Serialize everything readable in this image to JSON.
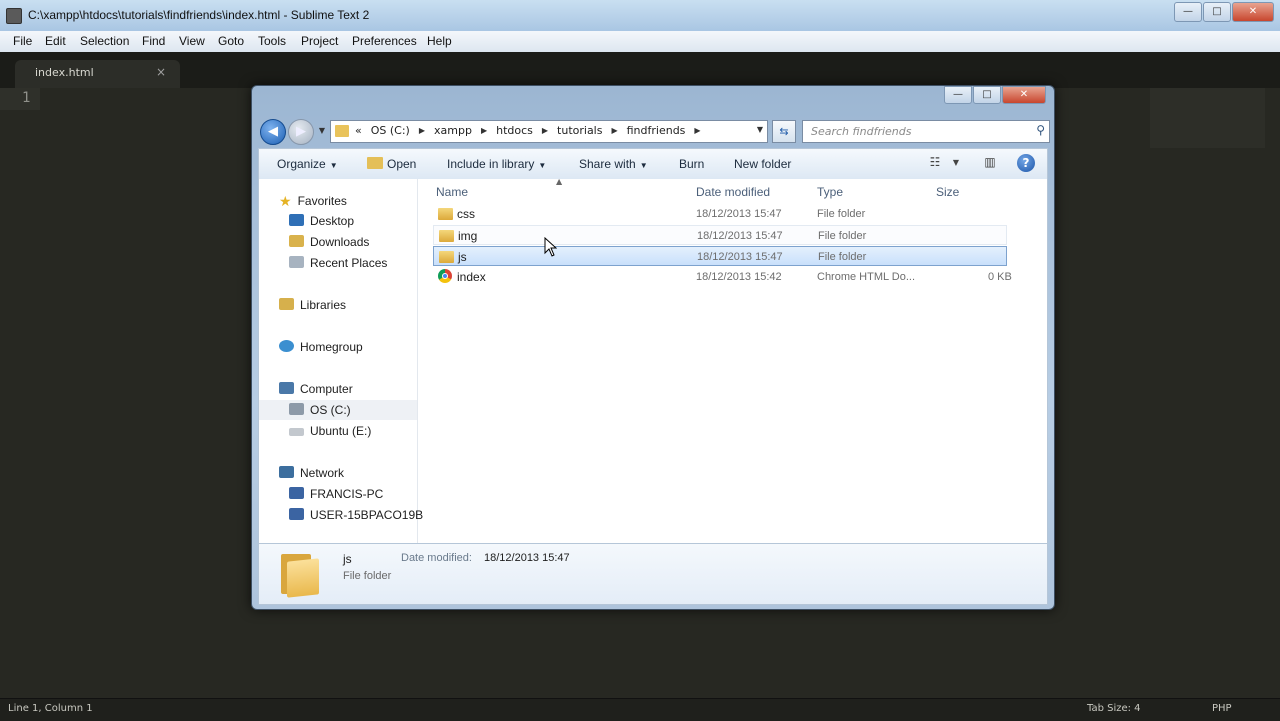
{
  "sublime": {
    "title": "C:\\xampp\\htdocs\\tutorials\\findfriends\\index.html - Sublime Text 2",
    "menu": [
      "File",
      "Edit",
      "Selection",
      "Find",
      "View",
      "Goto",
      "Tools",
      "Project",
      "Preferences",
      "Help"
    ],
    "tab": {
      "label": "index.html",
      "close": "×"
    },
    "line_number": "1",
    "status": {
      "position": "Line 1, Column 1",
      "tab_size": "Tab Size: 4",
      "syntax": "PHP"
    },
    "window_buttons": {
      "minimize": "—",
      "maximize": "□",
      "close": "✕"
    }
  },
  "explorer": {
    "window_buttons": {
      "minimize": "—",
      "maximize": "□",
      "close": "✕"
    },
    "address": {
      "lead": "«",
      "crumbs": [
        "OS (C:)",
        "xampp",
        "htdocs",
        "tutorials",
        "findfriends"
      ]
    },
    "search_placeholder": "Search findfriends",
    "toolbar": {
      "organize": "Organize",
      "open": "Open",
      "include": "Include in library",
      "share": "Share with",
      "burn": "Burn",
      "new_folder": "New folder"
    },
    "nav": {
      "favorites": "Favorites",
      "desktop": "Desktop",
      "downloads": "Downloads",
      "recent": "Recent Places",
      "libraries": "Libraries",
      "homegroup": "Homegroup",
      "computer": "Computer",
      "os": "OS (C:)",
      "ubuntu": "Ubuntu (E:)",
      "network": "Network",
      "francis": "FRANCIS-PC",
      "user": "USER-15BPACO19B"
    },
    "columns": {
      "name": "Name",
      "date": "Date modified",
      "type": "Type",
      "size": "Size"
    },
    "files": [
      {
        "name": "css",
        "date": "18/12/2013 15:47",
        "type": "File folder",
        "size": ""
      },
      {
        "name": "img",
        "date": "18/12/2013 15:47",
        "type": "File folder",
        "size": ""
      },
      {
        "name": "js",
        "date": "18/12/2013 15:47",
        "type": "File folder",
        "size": ""
      },
      {
        "name": "index",
        "date": "18/12/2013 15:42",
        "type": "Chrome HTML Do...",
        "size": "0 KB"
      }
    ],
    "details": {
      "name": "js",
      "kind": "File folder",
      "date_label": "Date modified:",
      "date_value": "18/12/2013 15:47"
    },
    "colors": {
      "selection": "#c9e0fb",
      "folder": "#e9b84c",
      "editor_bg": "#272822"
    }
  }
}
